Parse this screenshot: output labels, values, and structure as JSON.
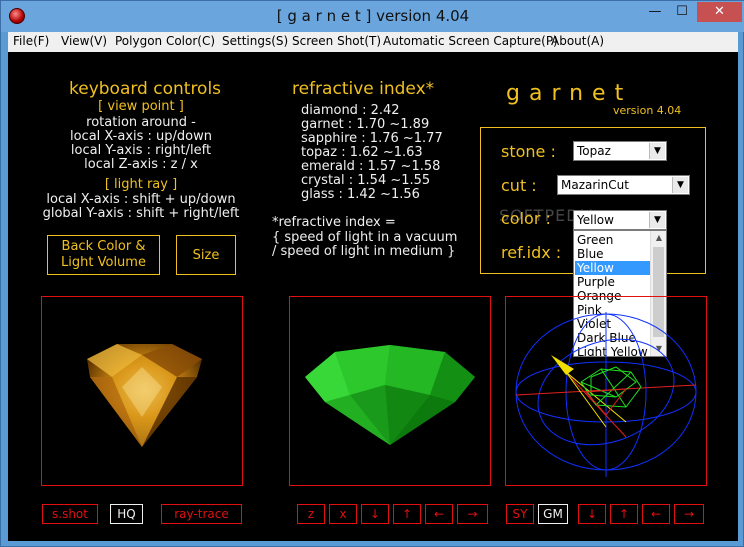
{
  "window": {
    "title": "[ g a r n e t ]  version 4.04",
    "min_label": "—",
    "max_label": "☐",
    "close_label": "✕"
  },
  "menu": [
    "File(F)",
    "View(V)",
    "Polygon Color(C)",
    "Settings(S)",
    "Screen Shot(T)",
    "Automatic Screen Capture(P)",
    "About(A)"
  ],
  "keyboard": {
    "title": "keyboard controls",
    "lines": [
      "[ view point ]",
      "rotation around -",
      "local X-axis : up/down",
      "local Y-axis : right/left",
      "local Z-axis : z / x",
      "[ light ray ]",
      "local X-axis : shift + up/down",
      "global Y-axis : shift + right/left"
    ]
  },
  "buttons": {
    "back_color": "Back Color &\nLight Volume",
    "size": "Size"
  },
  "refractive": {
    "title": "refractive index*",
    "rows": [
      "diamond  : 2.42",
      "garnet   : 1.70 ~1.89",
      "sapphire : 1.76 ~1.77",
      "topaz    : 1.62 ~1.63",
      "emerald  : 1.57 ~1.58",
      "crystal  : 1.54 ~1.55",
      "glass    : 1.42 ~1.56"
    ],
    "note": [
      "*refractive index =",
      "{ speed of light in a vacuum",
      " / speed of light in medium }"
    ]
  },
  "brand": {
    "name": "garnet",
    "version": "version 4.04"
  },
  "settings": {
    "stone_label": "stone :",
    "stone_value": "Topaz",
    "cut_label": "cut :",
    "cut_value": "MazarinCut",
    "color_label": "color :",
    "color_value": "Yellow",
    "refidx_label": "ref.idx :"
  },
  "color_options": [
    "Green",
    "Blue",
    "Yellow",
    "Purple",
    "Orange",
    "Pink",
    "Violet",
    "Dark Blue",
    "Light Yellow"
  ],
  "color_selected": "Yellow",
  "watermark": "SOFTPEDIA",
  "view_buttons": {
    "left": [
      "s.shot",
      "HQ",
      "ray-trace"
    ],
    "middle": [
      "z",
      "x",
      "↓",
      "↑",
      "←",
      "→"
    ],
    "right": [
      "SY",
      "GM",
      "↓",
      "↑",
      "←",
      "→"
    ]
  },
  "colors": {
    "accent": "#f0c020",
    "frame": "#e01010",
    "background": "#000000"
  }
}
